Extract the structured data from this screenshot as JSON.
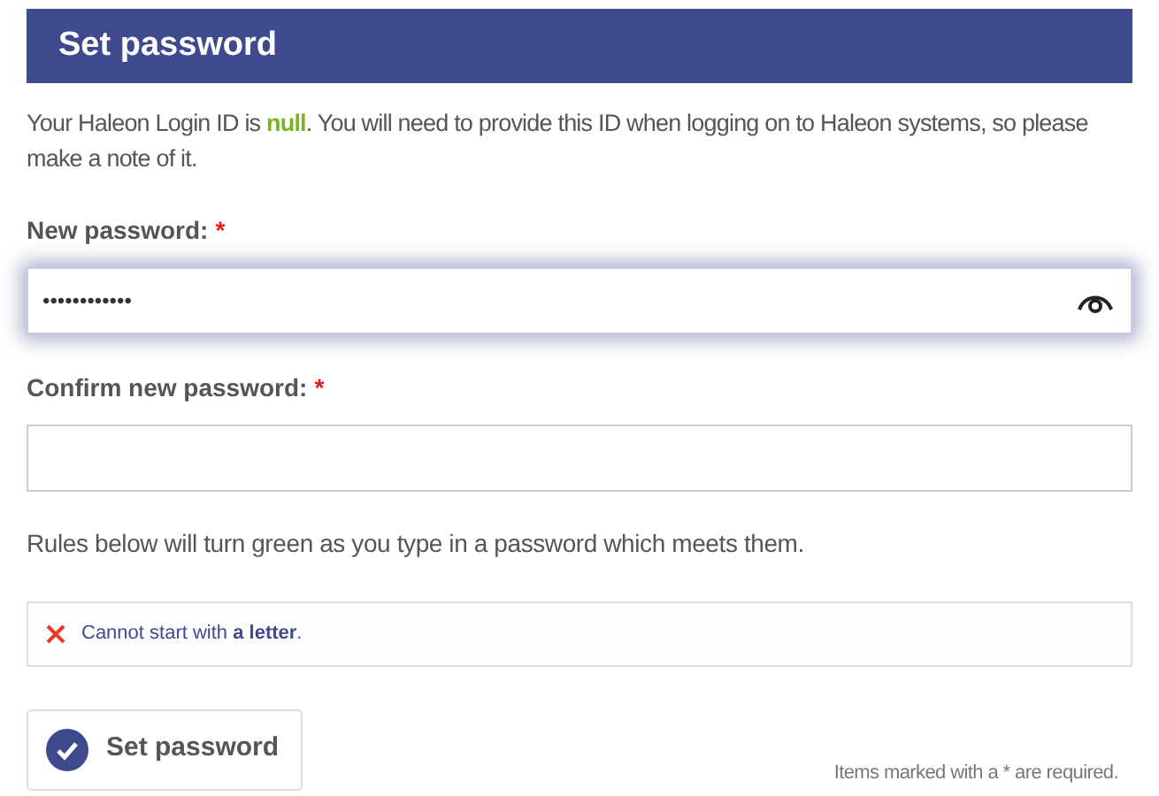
{
  "header": {
    "title": "Set password"
  },
  "intro": "Your Haleon Login ID is **null**. You will need to provide this ID when logging on to Haleon systems, so please make a note of it.",
  "fields": [
    {
      "label": "New password:",
      "required_mark": "*",
      "value": "••••••••••••",
      "focused": true,
      "reveal_toggle": true
    },
    {
      "label": "Confirm new password:",
      "required_mark": "*",
      "focused": false,
      "reveal_toggle": false
    }
  ],
  "rules_hint": "Rules below will turn green as you type in a password which meets them.",
  "rules": [
    {
      "text": "Cannot start with **a letter**.",
      "met": false
    }
  ],
  "submit": {
    "label": "Set password"
  },
  "footnote": "Items marked with a * are required."
}
